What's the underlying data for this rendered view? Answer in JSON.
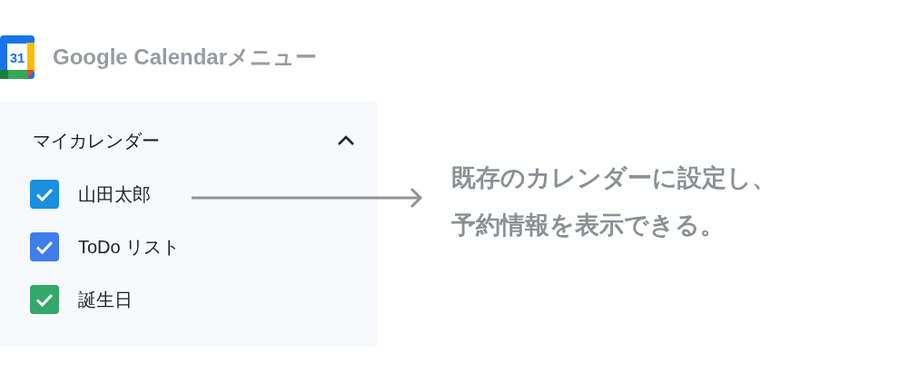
{
  "header": {
    "logo_text": "31",
    "title": "Google Calendarメニュー"
  },
  "panel": {
    "title": "マイカレンダー",
    "expanded": true,
    "calendars": [
      {
        "label": "山田太郎",
        "checked": true,
        "color": "#1a8fe0"
      },
      {
        "label": "ToDo リスト",
        "checked": true,
        "color": "#3f7ee8"
      },
      {
        "label": "誕生日",
        "checked": true,
        "color": "#33a86a"
      }
    ]
  },
  "annotation": {
    "lines": [
      "既存のカレンダーに設定し、",
      "予約情報を表示できる。"
    ]
  }
}
